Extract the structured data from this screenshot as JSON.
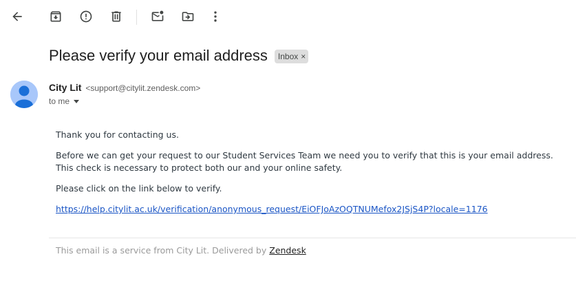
{
  "toolbar": {
    "icons": [
      "back-arrow-icon",
      "archive-icon",
      "report-spam-icon",
      "delete-icon",
      "mark-unread-icon",
      "move-to-icon",
      "more-vert-icon"
    ]
  },
  "email": {
    "subject": "Please verify your email address",
    "label": "Inbox",
    "label_remove": "×",
    "sender_name": "City Lit",
    "sender_email": "<support@citylit.zendesk.com>",
    "recipient": "to me",
    "body": {
      "p1": "Thank you for contacting us.",
      "p2": "Before we can get your request to our Student Services Team we need you to verify that this is your email address. This check is necessary to protect both our and your online safety.",
      "p3": "Please click on the link below to verify.",
      "link": "https://help.citylit.ac.uk/verification/anonymous_request/EiOFJoAzOQTNUMefox2JSjS4P?locale=1176"
    },
    "footer": {
      "text": "This email is a service from City Lit. Delivered by ",
      "link": "Zendesk"
    }
  },
  "colors": {
    "avatar": "#a8c7fa",
    "avatar_figure": "#1a6fd8",
    "link": "#1a55c5",
    "label_chip": "#dddddd"
  }
}
